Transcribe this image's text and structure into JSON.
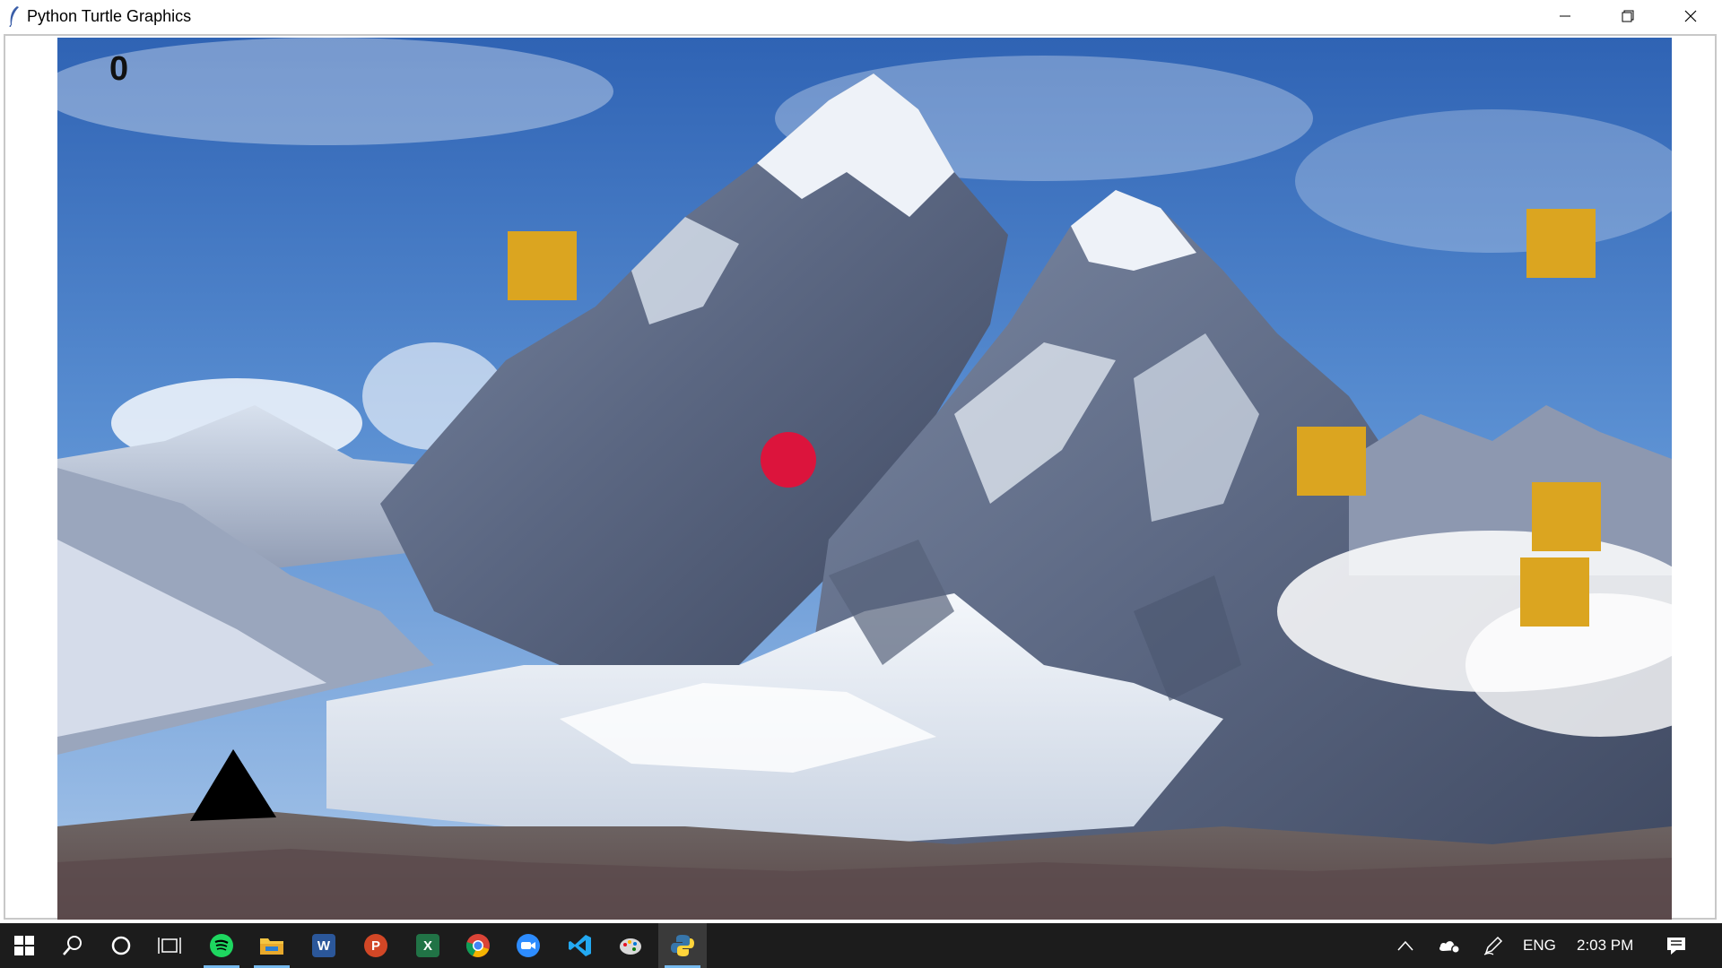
{
  "window": {
    "title": "Python Turtle Graphics",
    "icon": "feather-icon",
    "controls": [
      "minimize-icon",
      "maximize-icon",
      "close-icon"
    ]
  },
  "game": {
    "score": "0",
    "background": "snowy-mountain-photo",
    "block_color": "#dba520",
    "ball_color": "#dc143c",
    "player_color": "#000000",
    "block_count": 5
  },
  "taskbar": {
    "apps": [
      {
        "name": "start-button",
        "icon": "windows-icon"
      },
      {
        "name": "search",
        "icon": "search-icon"
      },
      {
        "name": "cortana",
        "icon": "cortana-icon"
      },
      {
        "name": "task-view",
        "icon": "task-view-icon"
      },
      {
        "name": "spotify",
        "icon": "spotify-icon"
      },
      {
        "name": "file-explorer",
        "icon": "folder-icon"
      },
      {
        "name": "word",
        "icon": "word-icon",
        "letter": "W"
      },
      {
        "name": "powerpoint",
        "icon": "powerpoint-icon",
        "letter": "P"
      },
      {
        "name": "excel",
        "icon": "excel-icon",
        "letter": "X"
      },
      {
        "name": "chrome",
        "icon": "chrome-icon"
      },
      {
        "name": "zoom",
        "icon": "zoom-icon"
      },
      {
        "name": "vscode",
        "icon": "vscode-icon"
      },
      {
        "name": "paint",
        "icon": "paint-icon"
      },
      {
        "name": "python",
        "icon": "python-icon"
      }
    ],
    "tray": {
      "language": "ENG",
      "time": "2:03 PM"
    }
  }
}
